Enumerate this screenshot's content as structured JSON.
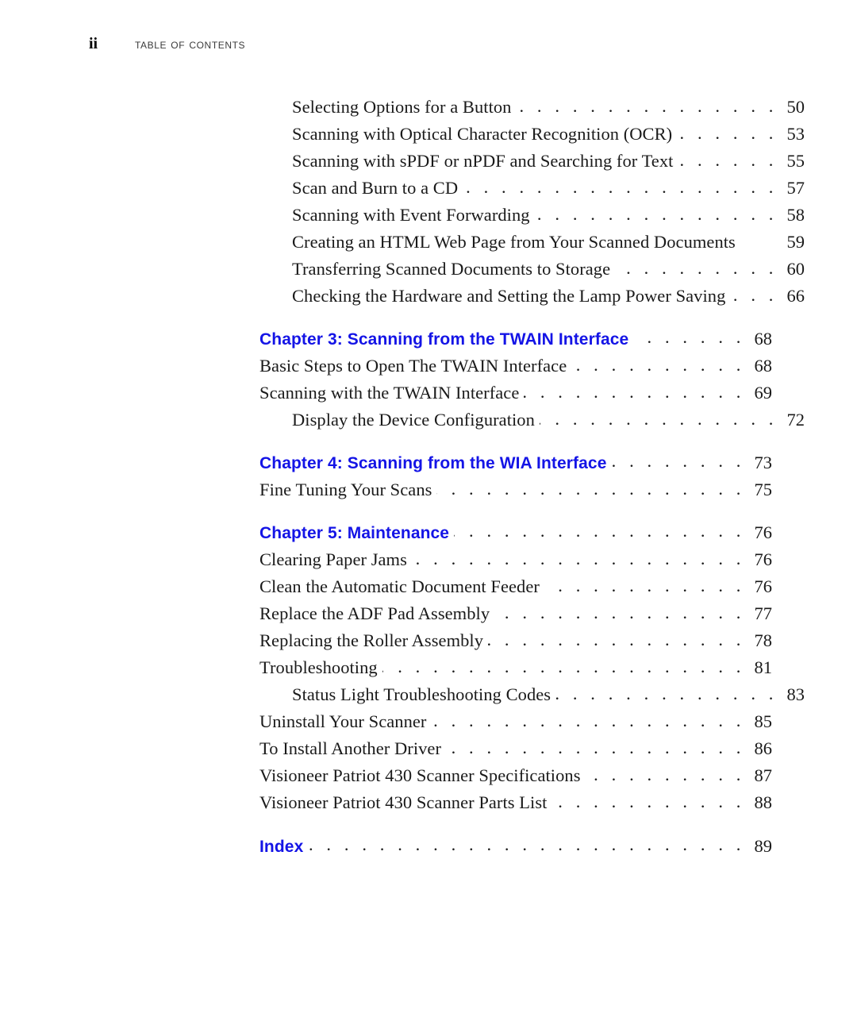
{
  "header": {
    "folio": "ii",
    "title": "Table of Contents"
  },
  "colors": {
    "chapter_blue": "#1414e6",
    "body_text": "#1a1a1a",
    "header_text": "#3a3a3a",
    "page_background": "#ffffff"
  },
  "toc": {
    "entries": [
      {
        "title": "Selecting Options for a Button",
        "page": "50",
        "level": 2,
        "style": "normal",
        "leader": true
      },
      {
        "title": "Scanning with Optical Character Recognition (OCR)",
        "page": "53",
        "level": 2,
        "style": "normal",
        "leader": true
      },
      {
        "title": "Scanning with sPDF or nPDF and Searching for Text",
        "page": "55",
        "level": 2,
        "style": "normal",
        "leader": true
      },
      {
        "title": "Scan and Burn to a CD",
        "page": "57",
        "level": 2,
        "style": "normal",
        "leader": true
      },
      {
        "title": "Scanning with Event Forwarding",
        "page": "58",
        "level": 2,
        "style": "normal",
        "leader": true
      },
      {
        "title": "Creating an HTML Web Page from Your Scanned Documents",
        "page": "59",
        "level": 2,
        "style": "normal",
        "leader": false
      },
      {
        "title": "Transferring Scanned Documents to Storage",
        "page": "60",
        "level": 2,
        "style": "normal",
        "leader": true
      },
      {
        "title": "Checking the Hardware and Setting the Lamp Power Saving",
        "page": "66",
        "level": 2,
        "style": "normal",
        "leader": true
      },
      {
        "title": "Chapter 3:  Scanning from the TWAIN Interface",
        "page": "68",
        "level": 1,
        "style": "chapter",
        "leader": true
      },
      {
        "title": "Basic Steps to Open The TWAIN Interface",
        "page": "68",
        "level": 1,
        "style": "normal",
        "leader": true
      },
      {
        "title": "Scanning with the TWAIN Interface",
        "page": "69",
        "level": 1,
        "style": "normal",
        "leader": true
      },
      {
        "title": "Display the Device Configuration",
        "page": "72",
        "level": 2,
        "style": "normal",
        "leader": true
      },
      {
        "title": "Chapter 4:  Scanning from the WIA Interface",
        "page": "73",
        "level": 1,
        "style": "chapter",
        "leader": true
      },
      {
        "title": "Fine Tuning Your Scans",
        "page": "75",
        "level": 1,
        "style": "normal",
        "leader": true
      },
      {
        "title": "Chapter 5:  Maintenance",
        "page": "76",
        "level": 1,
        "style": "chapter",
        "leader": true
      },
      {
        "title": "Clearing Paper Jams",
        "page": "76",
        "level": 1,
        "style": "normal",
        "leader": true
      },
      {
        "title": "Clean the Automatic Document Feeder",
        "page": "76",
        "level": 1,
        "style": "normal",
        "leader": true
      },
      {
        "title": "Replace the ADF Pad Assembly",
        "page": "77",
        "level": 1,
        "style": "normal",
        "leader": true
      },
      {
        "title": "Replacing the Roller Assembly",
        "page": "78",
        "level": 1,
        "style": "normal",
        "leader": true
      },
      {
        "title": "Troubleshooting",
        "page": "81",
        "level": 1,
        "style": "normal",
        "leader": true
      },
      {
        "title": "Status Light Troubleshooting Codes",
        "page": "83",
        "level": 2,
        "style": "normal",
        "leader": true
      },
      {
        "title": "Uninstall Your Scanner",
        "page": "85",
        "level": 1,
        "style": "normal",
        "leader": true
      },
      {
        "title": "To Install Another Driver",
        "page": "86",
        "level": 1,
        "style": "normal",
        "leader": true
      },
      {
        "title": "Visioneer Patriot 430 Scanner Specifications",
        "page": "87",
        "level": 1,
        "style": "normal",
        "leader": true
      },
      {
        "title": "Visioneer Patriot 430 Scanner Parts List",
        "page": "88",
        "level": 1,
        "style": "normal",
        "leader": true
      },
      {
        "title": "Index",
        "page": "89",
        "level": 1,
        "style": "index",
        "leader": true
      }
    ],
    "leader_dots": ". . . . . . . . . . . . . . . . . . . . . . . . . . . . . . . . . . . . . . . . . . . . . . . . . . . . . . . . . . . . . . . . . ."
  }
}
